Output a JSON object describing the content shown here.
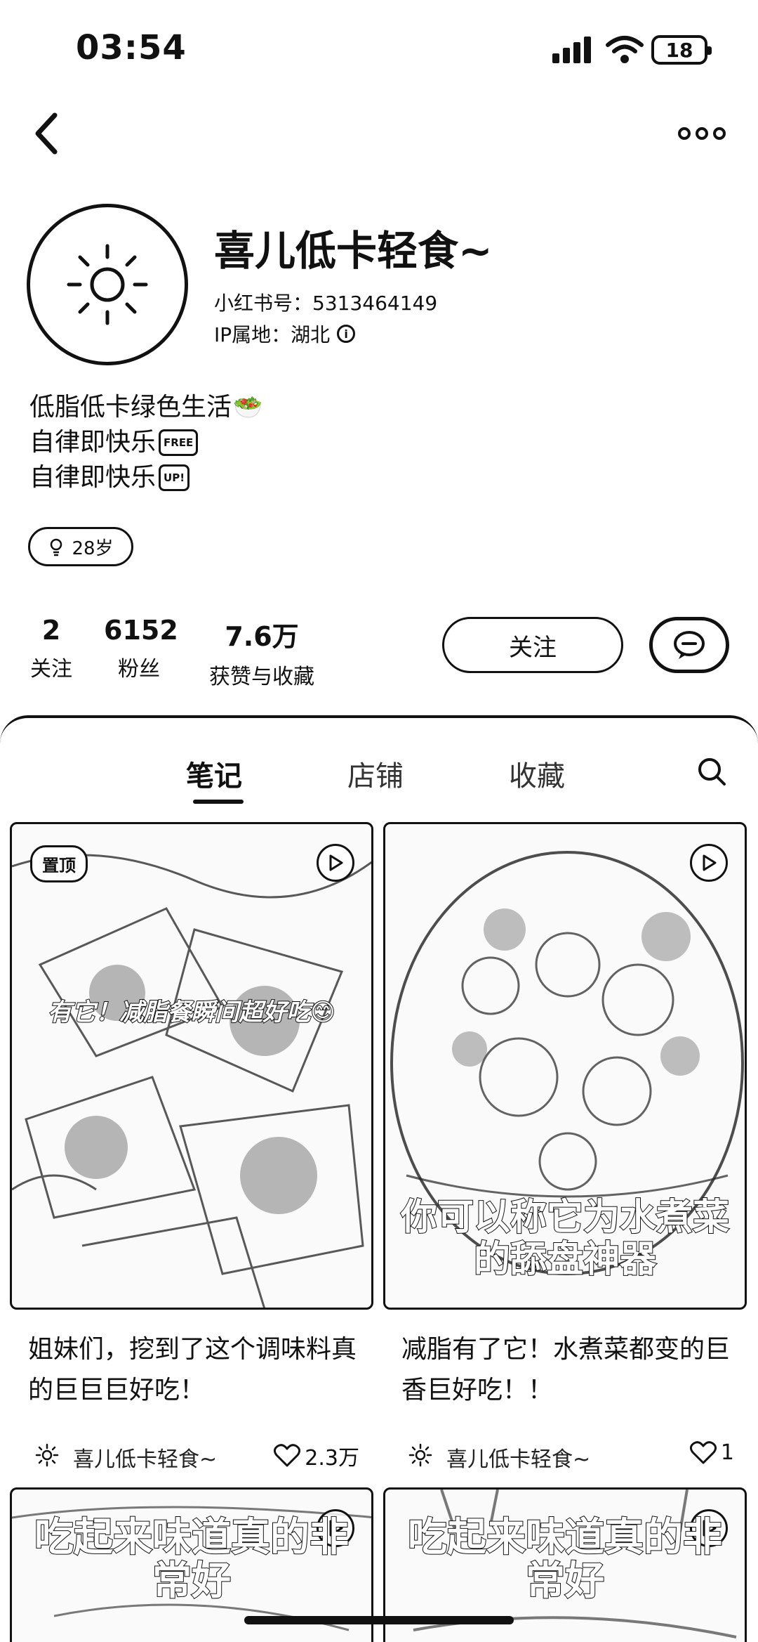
{
  "status": {
    "time": "03:54",
    "battery": "18"
  },
  "profile": {
    "name": "喜儿低卡轻食~",
    "xhs_id": "小红书号：5313464149",
    "ip": "IP属地：湖北",
    "bio": [
      {
        "text": "低脂低卡绿色生活",
        "badge": "🥗"
      },
      {
        "text": "自律即快乐",
        "badge": "FREE"
      },
      {
        "text": "自律即快乐",
        "badge": "UP!"
      }
    ],
    "age_tag": "28岁"
  },
  "stats": {
    "following": {
      "value": "2",
      "label": "关注"
    },
    "fans": {
      "value": "6152",
      "label": "粉丝"
    },
    "likes": {
      "value": "7.6万",
      "label": "获赞与收藏"
    }
  },
  "actions": {
    "follow_label": "关注"
  },
  "tabs": {
    "notes": "笔记",
    "shop": "店铺",
    "collect": "收藏"
  },
  "cards": [
    {
      "pin": "置顶",
      "overlay": "有它！减脂餐瞬间超好吃😊",
      "title": "姐妹们，挖到了这个调味料真的巨巨巨好吃！",
      "author": "喜儿低卡轻食~",
      "likes": "2.3万"
    },
    {
      "overlay": "你可以称它为水煮菜的舔盘神器",
      "title": "减脂有了它！水煮菜都变的巨香巨好吃！！",
      "author": "喜儿低卡轻食~",
      "likes": "1"
    },
    {
      "overlay": "吃起来味道真的非常好"
    },
    {
      "overlay": "吃起来味道真的非常好"
    }
  ]
}
